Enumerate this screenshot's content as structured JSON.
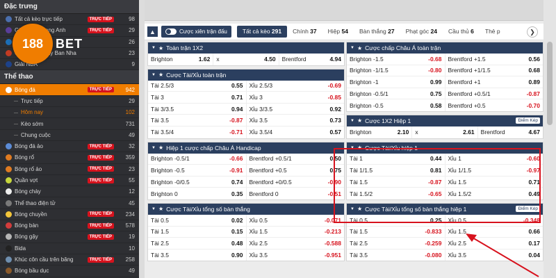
{
  "sidebar": {
    "section1": "Đặc trưng",
    "featured": [
      {
        "label": "Tất cả kèo trực tiếp",
        "live": "TRỰC TIẾP",
        "count": "98",
        "icon": "#4b6fae"
      },
      {
        "label": "Giải Ngoại hạng Anh",
        "live": "TRỰC TIẾP",
        "count": "29",
        "icon": "#5a3e9a"
      },
      {
        "label": "Giải Ý",
        "live": "",
        "count": "26",
        "icon": "#1c6fb8"
      },
      {
        "label": "Giải VĐQG Tây Ban Nha",
        "live": "",
        "count": "23",
        "icon": "#c23b22"
      },
      {
        "label": "Giải NBA",
        "live": "",
        "count": "9",
        "icon": "#1d428a"
      }
    ],
    "section2": "Thể thao",
    "sports": [
      {
        "label": "Bóng đá",
        "live": "TRỰC TIẾP",
        "count": "942",
        "icon": "#ffffff",
        "kind": "active"
      },
      {
        "label": "Trực tiếp",
        "live": "",
        "count": "29",
        "kind": "sub"
      },
      {
        "label": "Hôm nay",
        "live": "",
        "count": "102",
        "kind": "sub hl"
      },
      {
        "label": "Kèo sớm",
        "live": "",
        "count": "731",
        "kind": "sub"
      },
      {
        "label": "Chung cuộc",
        "live": "",
        "count": "49",
        "kind": "sub"
      },
      {
        "label": "Bóng đá ảo",
        "live": "TRỰC TIẾP",
        "count": "32",
        "icon": "#5b8bd6"
      },
      {
        "label": "Bóng rổ",
        "live": "TRỰC TIẾP",
        "count": "359",
        "icon": "#e07b21"
      },
      {
        "label": "Bóng rổ ảo",
        "live": "TRỰC TIẾP",
        "count": "23",
        "icon": "#e07b21"
      },
      {
        "label": "Quần vợt",
        "live": "TRỰC TIẾP",
        "count": "55",
        "icon": "#c6d63c"
      },
      {
        "label": "Bóng chày",
        "live": "",
        "count": "12",
        "icon": "#eeeeee"
      },
      {
        "label": "Thể thao điện tử",
        "live": "",
        "count": "45",
        "icon": "#7a7a7a"
      },
      {
        "label": "Bóng chuyền",
        "live": "TRỰC TIẾP",
        "count": "234",
        "icon": "#f3c53a"
      },
      {
        "label": "Bóng bàn",
        "live": "TRỰC TIẾP",
        "count": "578",
        "icon": "#d23c3c"
      },
      {
        "label": "Bóng gậy",
        "live": "TRỰC TIẾP",
        "count": "19",
        "icon": "#b5b5b5"
      },
      {
        "label": "Bida",
        "live": "",
        "count": "10",
        "icon": "#222222"
      },
      {
        "label": "Khúc côn cầu trên băng",
        "live": "TRỰC TIẾP",
        "count": "258",
        "icon": "#6f8fb0"
      },
      {
        "label": "Bóng bầu dục",
        "live": "",
        "count": "49",
        "icon": "#8b5a2b"
      }
    ]
  },
  "logo": {
    "circle": "188",
    "text": "BET"
  },
  "tabs": {
    "toggle_label": "Cược xiên trận đấu",
    "items": [
      {
        "label": "Tất cả kèo",
        "count": "291",
        "active": true
      },
      {
        "label": "Chính",
        "count": "37"
      },
      {
        "label": "Hiệp",
        "count": "54"
      },
      {
        "label": "Bàn thắng",
        "count": "27"
      },
      {
        "label": "Phạt góc",
        "count": "24"
      },
      {
        "label": "Cầu thủ",
        "count": "6"
      },
      {
        "label": "Thẻ p",
        "count": ""
      }
    ]
  },
  "badge_label": "Điểm Kép",
  "left_panels": [
    {
      "title": "Toàn trận 1X2",
      "badge": false,
      "cols": 3,
      "rows": [
        [
          [
            "Brighton",
            "1.62",
            false
          ],
          [
            "x",
            "4.50",
            false
          ],
          [
            "Brentford",
            "4.94",
            false
          ]
        ]
      ]
    },
    {
      "title": "Cược Tài/Xỉu toàn trận",
      "badge": false,
      "cols": 2,
      "rows": [
        [
          [
            "Tài 2.5/3",
            "0.55",
            false
          ],
          [
            "Xỉu 2.5/3",
            "-0.69",
            true
          ]
        ],
        [
          [
            "Tài 3",
            "0.71",
            false
          ],
          [
            "Xỉu 3",
            "-0.85",
            true
          ]
        ],
        [
          [
            "Tài 3/3.5",
            "0.94",
            false
          ],
          [
            "Xỉu 3/3.5",
            "0.92",
            false
          ]
        ],
        [
          [
            "Tài 3.5",
            "-0.87",
            true
          ],
          [
            "Xỉu 3.5",
            "0.73",
            false
          ]
        ],
        [
          [
            "Tài 3.5/4",
            "-0.71",
            true
          ],
          [
            "Xỉu 3.5/4",
            "0.57",
            false
          ]
        ]
      ]
    },
    {
      "title": "Hiệp 1 cược chấp Châu Á Handicap",
      "badge": false,
      "cols": 2,
      "rows": [
        [
          [
            "Brighton -0.5/1",
            "-0.66",
            true
          ],
          [
            "Brentford +0.5/1",
            "0.50",
            false
          ]
        ],
        [
          [
            "Brighton -0.5",
            "-0.91",
            true
          ],
          [
            "Brentford +0.5",
            "0.75",
            false
          ]
        ],
        [
          [
            "Brighton -0/0.5",
            "0.74",
            false
          ],
          [
            "Brentford +0/0.5",
            "-0.90",
            true
          ]
        ],
        [
          [
            "Brighton 0",
            "0.35",
            false
          ],
          [
            "Brentford 0",
            "-0.51",
            true
          ]
        ]
      ]
    },
    {
      "title": "Cược Tài/Xỉu tổng số bàn thắng",
      "badge": false,
      "cols": 2,
      "rows": [
        [
          [
            "Tài 0.5",
            "0.02",
            false
          ],
          [
            "Xỉu 0.5",
            "-0.071",
            true
          ]
        ],
        [
          [
            "Tài 1.5",
            "0.15",
            false
          ],
          [
            "Xỉu 1.5",
            "-0.213",
            true
          ]
        ],
        [
          [
            "Tài 2.5",
            "0.48",
            false
          ],
          [
            "Xỉu 2.5",
            "-0.588",
            true
          ]
        ],
        [
          [
            "Tài 3.5",
            "0.90",
            false
          ],
          [
            "Xỉu 3.5",
            "-0.951",
            true
          ]
        ]
      ]
    }
  ],
  "right_panels": [
    {
      "title": "Cược chấp Châu Á toàn trận",
      "badge": false,
      "cols": 2,
      "rows": [
        [
          [
            "Brighton -1.5",
            "-0.68",
            true
          ],
          [
            "Brentford +1.5",
            "0.56",
            false
          ]
        ],
        [
          [
            "Brighton -1/1.5",
            "-0.80",
            true
          ],
          [
            "Brentford +1/1.5",
            "0.68",
            false
          ]
        ],
        [
          [
            "Brighton -1",
            "0.99",
            false
          ],
          [
            "Brentford +1",
            "0.89",
            false
          ]
        ],
        [
          [
            "Brighton -0.5/1",
            "0.75",
            false
          ],
          [
            "Brentford +0.5/1",
            "-0.87",
            true
          ]
        ],
        [
          [
            "Brighton -0.5",
            "0.58",
            false
          ],
          [
            "Brentford +0.5",
            "-0.70",
            true
          ]
        ]
      ]
    },
    {
      "title": "Cược 1X2 Hiệp 1",
      "badge": true,
      "cols": 3,
      "rows": [
        [
          [
            "Brighton",
            "2.10",
            false
          ],
          [
            "x",
            "2.61",
            false
          ],
          [
            "Brentford",
            "4.67",
            false
          ]
        ]
      ]
    },
    {
      "title": "Cược Tài/Xỉu hiệp 1",
      "badge": false,
      "cols": 2,
      "rows": [
        [
          [
            "Tài 1",
            "0.44",
            false
          ],
          [
            "Xỉu 1",
            "-0.60",
            true
          ]
        ],
        [
          [
            "Tài 1/1.5",
            "0.81",
            false
          ],
          [
            "Xỉu 1/1.5",
            "-0.97",
            true
          ]
        ],
        [
          [
            "Tài 1.5",
            "-0.87",
            true
          ],
          [
            "Xỉu 1.5",
            "0.71",
            false
          ]
        ],
        [
          [
            "Tài 1.5/2",
            "-0.65",
            true
          ],
          [
            "Xỉu 1.5/2",
            "0.49",
            false
          ]
        ]
      ]
    },
    {
      "title": "Cược Tài/Xỉu tổng số bàn thắng hiệp 1",
      "badge": true,
      "cols": 2,
      "rows": [
        [
          [
            "Tài 0.5",
            "0.25",
            false
          ],
          [
            "Xỉu 0.5",
            "-0.348",
            true
          ]
        ],
        [
          [
            "Tài 1.5",
            "-0.833",
            true
          ],
          [
            "Xỉu 1.5",
            "0.66",
            false
          ]
        ],
        [
          [
            "Tài 2.5",
            "-0.259",
            true
          ],
          [
            "Xỉu 2.5",
            "0.17",
            false
          ]
        ],
        [
          [
            "Tài 3.5",
            "-0.080",
            true
          ],
          [
            "Xỉu 3.5",
            "0.04",
            false
          ]
        ]
      ]
    }
  ],
  "colors": {
    "accent": "#f07d00",
    "header": "#2b3f5f",
    "negative": "#d7121d",
    "live": "#d7121d"
  }
}
